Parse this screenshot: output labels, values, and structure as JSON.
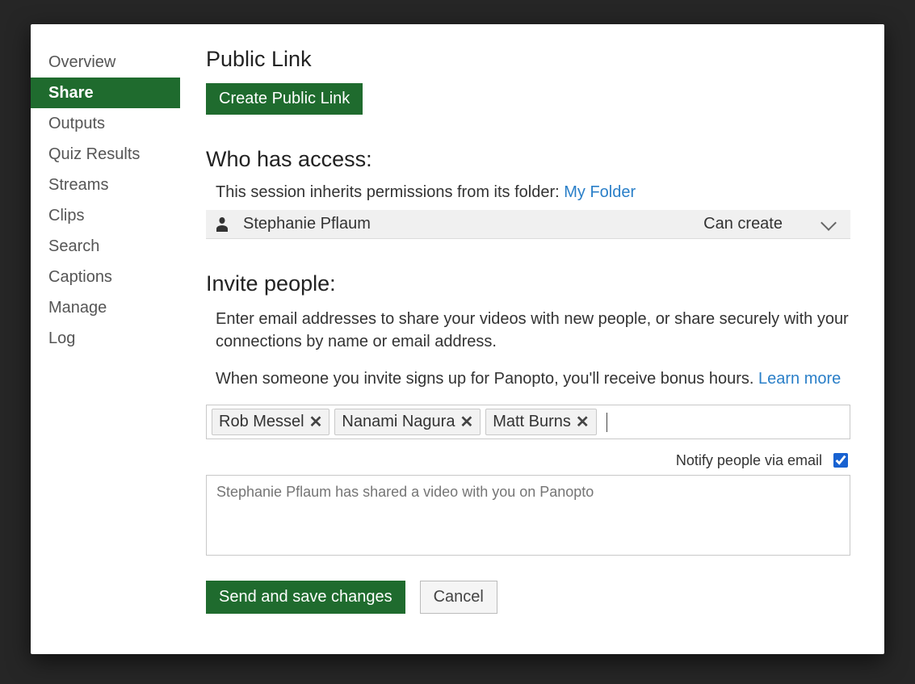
{
  "sidebar": {
    "items": [
      {
        "label": "Overview"
      },
      {
        "label": "Share"
      },
      {
        "label": "Outputs"
      },
      {
        "label": "Quiz Results"
      },
      {
        "label": "Streams"
      },
      {
        "label": "Clips"
      },
      {
        "label": "Search"
      },
      {
        "label": "Captions"
      },
      {
        "label": "Manage"
      },
      {
        "label": "Log"
      }
    ],
    "active_index": 1
  },
  "public_link": {
    "title": "Public Link",
    "create_button": "Create Public Link"
  },
  "access": {
    "title": "Who has access:",
    "inherit_text": "This session inherits permissions from its folder: ",
    "folder_link": "My Folder",
    "entries": [
      {
        "name": "Stephanie Pflaum",
        "permission": "Can create"
      }
    ]
  },
  "invite": {
    "title": "Invite people:",
    "desc": "Enter email addresses to share your videos with new people, or share securely with your connections by name or email address.",
    "bonus_text": "When someone you invite signs up for Panopto, you'll receive bonus hours.  ",
    "learn_more": "Learn more",
    "tags": [
      "Rob Messel",
      "Nanami Nagura",
      "Matt Burns"
    ],
    "notify_label": "Notify people via email",
    "notify_checked": true,
    "message_placeholder": "Stephanie Pflaum has shared a video with you on Panopto"
  },
  "actions": {
    "send": "Send and save changes",
    "cancel": "Cancel"
  }
}
